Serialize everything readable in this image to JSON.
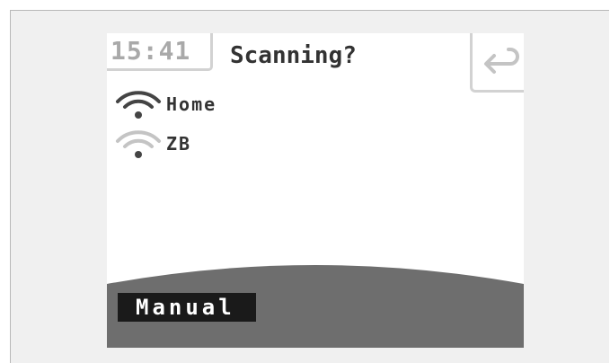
{
  "status": {
    "time": "15:41"
  },
  "header": {
    "title": "Scanning?",
    "back_icon": "return-arrow-icon"
  },
  "networks": [
    {
      "name": "Home",
      "icon": "wifi-icon",
      "signal": "strong"
    },
    {
      "name": "ZB",
      "icon": "wifi-icon",
      "signal": "weak"
    }
  ],
  "footer": {
    "manual_label": "Manual"
  },
  "colors": {
    "background": "#f0f0f0",
    "screen": "#ffffff",
    "bottom_bar": "#6e6e6e",
    "button": "#1a1a1a",
    "text": "#333333",
    "muted": "#a9a9a9",
    "border": "#d2d2d2"
  }
}
